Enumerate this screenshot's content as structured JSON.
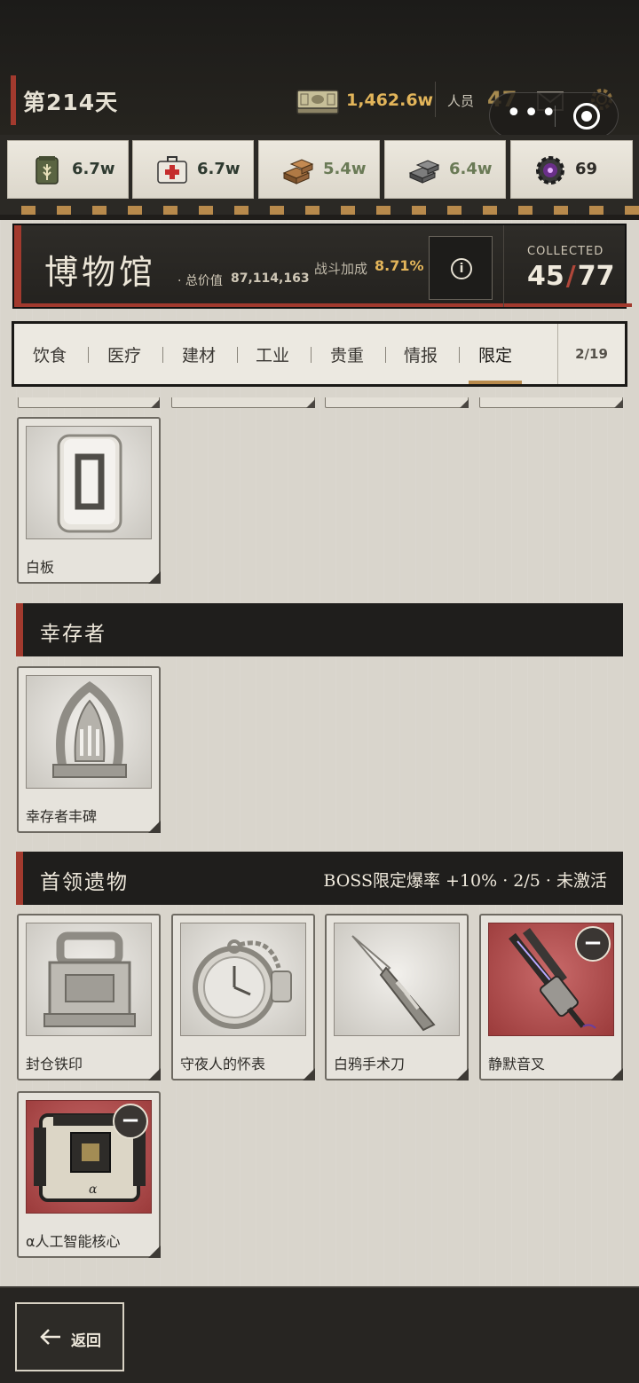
{
  "topbar": {
    "day": "第214天",
    "money": "1,462.6w",
    "people_label": "人员",
    "people_value": "47"
  },
  "resources": [
    {
      "icon": "grain-sack-icon",
      "value": "6.7w",
      "color": "#3c4a3a"
    },
    {
      "icon": "medkit-icon",
      "value": "6.7w",
      "color": "#3c4a3a"
    },
    {
      "icon": "lumber-icon",
      "value": "5.4w",
      "color": "#6d7a5a"
    },
    {
      "icon": "steel-ingot-icon",
      "value": "6.4w",
      "color": "#6d7a5a"
    },
    {
      "icon": "gear-core-icon",
      "value": "69",
      "color": "#2e2c28"
    }
  ],
  "museum": {
    "title": "博物馆",
    "total_label": "· 总价值",
    "total_value": "87,114,163",
    "bonus_label": "战斗加成",
    "bonus_value": "8.71%",
    "collected_label": "COLLECTED",
    "collected_count": "45",
    "collected_total": "77"
  },
  "tabs": {
    "items": [
      "饮食",
      "医疗",
      "建材",
      "工业",
      "贵重",
      "情报",
      "限定"
    ],
    "active": "限定",
    "page": "2/19"
  },
  "items_top": [
    {
      "name": "白板"
    }
  ],
  "section_survivor": {
    "title": "幸存者",
    "items": [
      {
        "name": "幸存者丰碑"
      }
    ]
  },
  "section_boss": {
    "title": "首领遗物",
    "note": "BOSS限定爆率 +10% · 2/5 · 未激活",
    "items": [
      {
        "name": "封仓铁印"
      },
      {
        "name": "守夜人的怀表"
      },
      {
        "name": "白鸦手术刀"
      },
      {
        "name": "静默音叉"
      },
      {
        "name": "α人工智能核心"
      }
    ]
  },
  "bottom": {
    "back_label": "返回"
  }
}
